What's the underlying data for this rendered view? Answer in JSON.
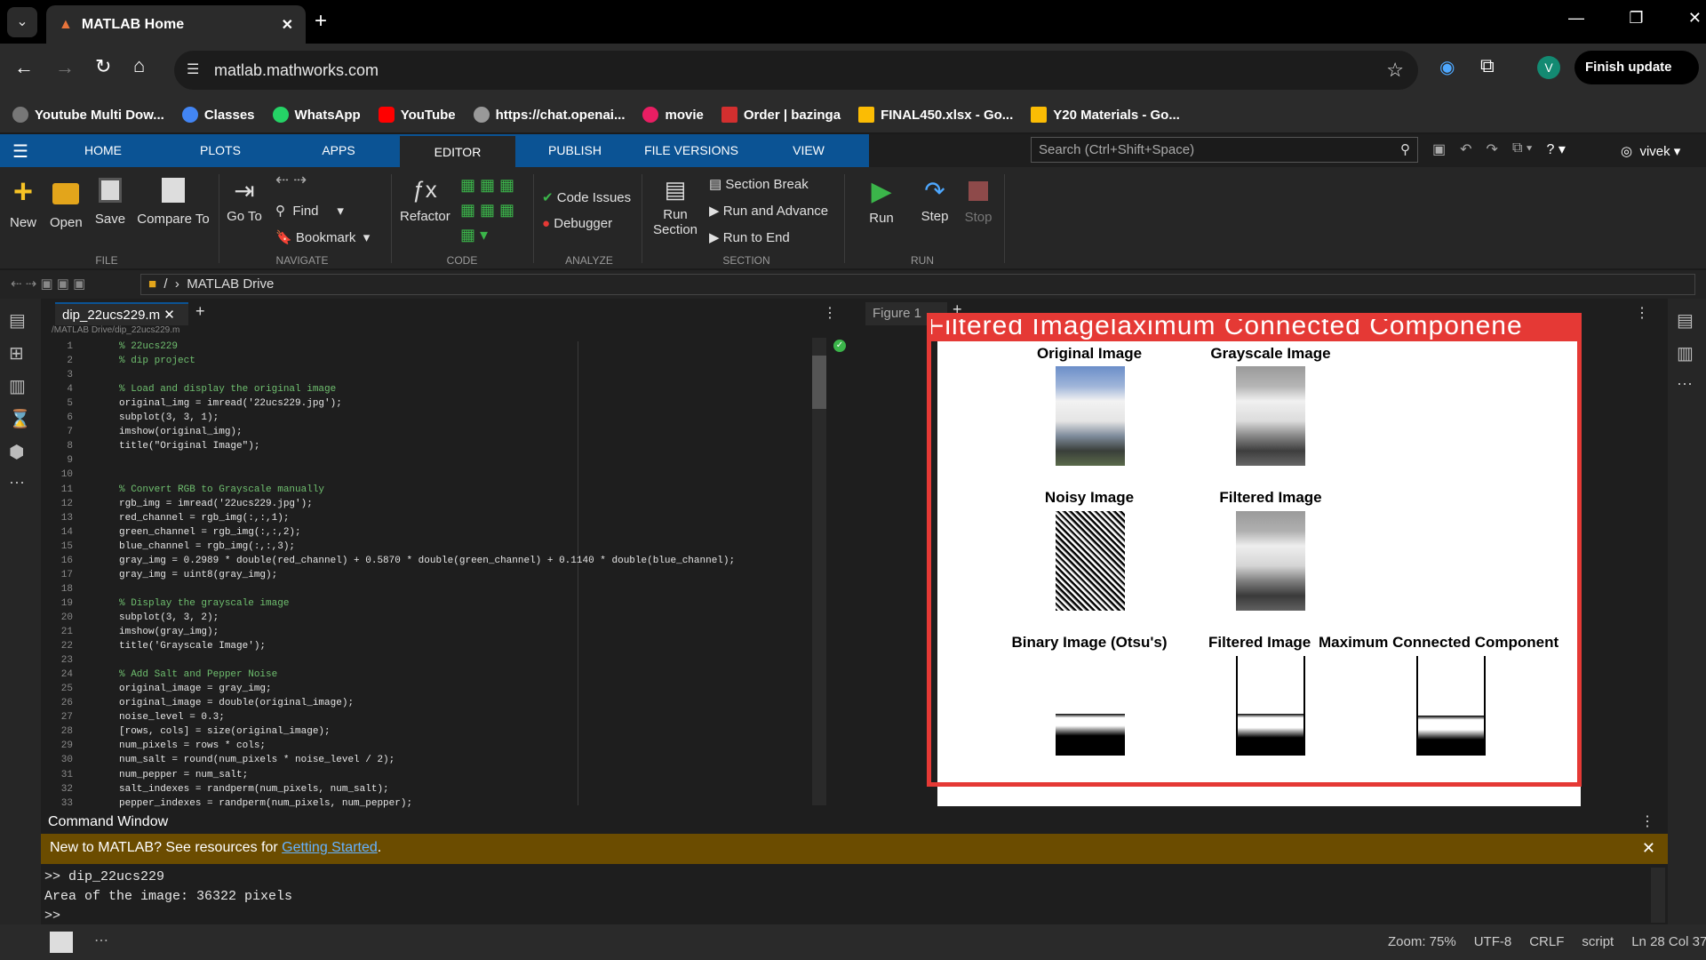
{
  "browser": {
    "tab_title": "MATLAB Home",
    "url": "matlab.mathworks.com",
    "profile_initial": "V",
    "finish_update": "Finish update"
  },
  "bookmarks": [
    "Youtube Multi Dow...",
    "Classes",
    "WhatsApp",
    "YouTube",
    "https://chat.openai...",
    "movie",
    "Order | bazinga",
    "FINAL450.xlsx - Go...",
    "Y20 Materials - Go..."
  ],
  "matlab_tabs": [
    "HOME",
    "PLOTS",
    "APPS",
    "EDITOR",
    "PUBLISH",
    "FILE VERSIONS",
    "VIEW"
  ],
  "search_placeholder": "Search (Ctrl+Shift+Space)",
  "user": "vivek",
  "ribbon": {
    "file": {
      "new": "New",
      "open": "Open",
      "save": "Save",
      "compare": "Compare To",
      "label": "FILE"
    },
    "navigate": {
      "goto": "Go To",
      "find": "Find",
      "bookmark": "Bookmark",
      "label": "NAVIGATE"
    },
    "code": {
      "refactor": "Refactor",
      "label": "CODE"
    },
    "analyze": {
      "issues": "Code Issues",
      "debugger": "Debugger",
      "label": "ANALYZE"
    },
    "section": {
      "run_section": "Run",
      "run_section2": "Section",
      "break": "Section Break",
      "run_adv": "Run and Advance",
      "run_end": "Run to End",
      "label": "SECTION"
    },
    "run": {
      "run": "Run",
      "step": "Step",
      "stop": "Stop",
      "label": "RUN"
    }
  },
  "address": {
    "root": "/",
    "folder": "MATLAB Drive"
  },
  "editor": {
    "file_tab": "dip_22ucs229.m",
    "path": "/MATLAB Drive/dip_22ucs229.m"
  },
  "code_lines": [
    "% 22ucs229",
    "% dip project",
    "",
    "% Load and display the original image",
    "original_img = imread('22ucs229.jpg');",
    "subplot(3, 3, 1);",
    "imshow(original_img);",
    "title(\"Original Image\");",
    "",
    "",
    "% Convert RGB to Grayscale manually",
    "rgb_img = imread('22ucs229.jpg');",
    "red_channel = rgb_img(:,:,1);",
    "green_channel = rgb_img(:,:,2);",
    "blue_channel = rgb_img(:,:,3);",
    "gray_img = 0.2989 * double(red_channel) + 0.5870 * double(green_channel) + 0.1140 * double(blue_channel);",
    "gray_img = uint8(gray_img);",
    "",
    "% Display the grayscale image",
    "subplot(3, 3, 2);",
    "imshow(gray_img);",
    "title('Grayscale Image');",
    "",
    "% Add Salt and Pepper Noise",
    "original_image = gray_img;",
    "original_image = double(original_image);",
    "noise_level = 0.3;",
    "[rows, cols] = size(original_image);",
    "num_pixels = rows * cols;",
    "num_salt = round(num_pixels * noise_level / 2);",
    "num_pepper = num_salt;",
    "salt_indexes = randperm(num_pixels, num_salt);",
    "pepper_indexes = randperm(num_pixels, num_pepper);"
  ],
  "figure": {
    "tab": "Figure 1",
    "overlay_title": "Filtered Imagelaximum Connected Componene",
    "subplots": [
      "Original Image",
      "Grayscale Image",
      "Noisy Image",
      "Filtered Image",
      "Binary Image (Otsu's)",
      "Filtered Image",
      "Maximum Connected Component"
    ]
  },
  "command": {
    "title": "Command Window",
    "banner_text": "New to MATLAB? See resources for ",
    "banner_link": "Getting Started",
    "banner_end": ".",
    "lines": [
      ">> dip_22ucs229",
      "Area of the image: 36322 pixels",
      ">>"
    ]
  },
  "status": {
    "zoom": "Zoom: 75%",
    "encoding": "UTF-8",
    "eol": "CRLF",
    "type": "script",
    "pos": "Ln 28 Col 37"
  },
  "colors": {
    "accent": "#0b5394",
    "banner": "#6b4c00",
    "annotation": "#e53935"
  }
}
